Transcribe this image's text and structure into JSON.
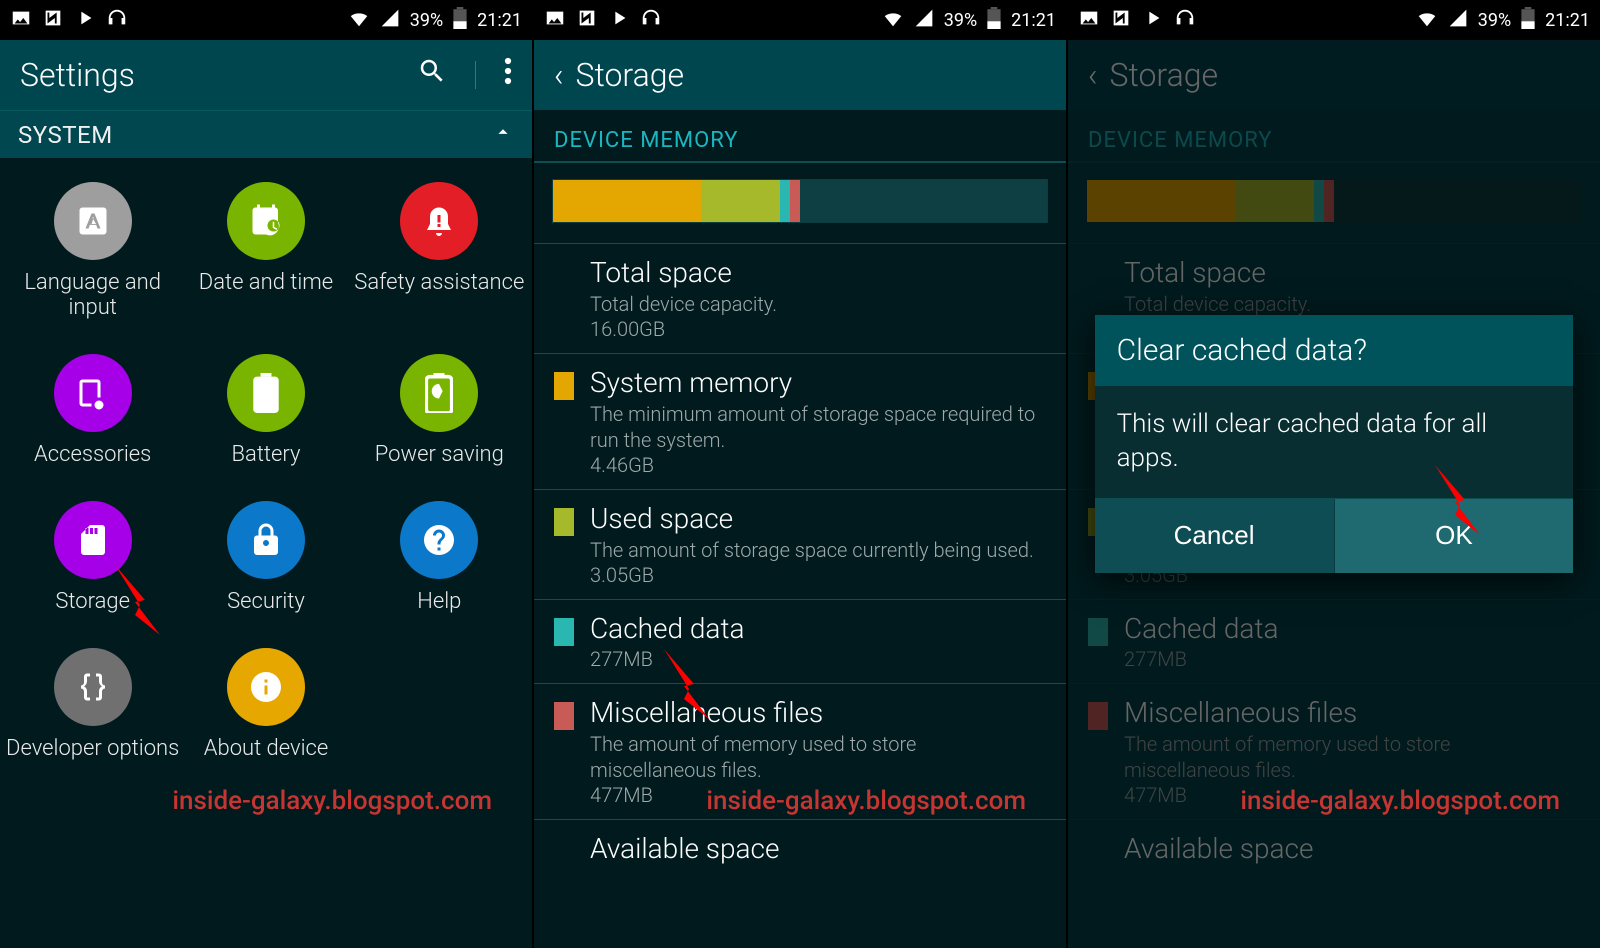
{
  "status_bar": {
    "battery_text": "39%",
    "time": "21:21"
  },
  "watermark": "inside-galaxy.blogspot.com",
  "screen1": {
    "header_title": "Settings",
    "section": "SYSTEM",
    "items": [
      {
        "label": "Language and input"
      },
      {
        "label": "Date and time"
      },
      {
        "label": "Safety assistance"
      },
      {
        "label": "Accessories"
      },
      {
        "label": "Battery"
      },
      {
        "label": "Power saving"
      },
      {
        "label": "Storage"
      },
      {
        "label": "Security"
      },
      {
        "label": "Help"
      },
      {
        "label": "Developer options"
      },
      {
        "label": "About device"
      }
    ]
  },
  "screen2": {
    "header_title": "Storage",
    "section": "DEVICE MEMORY",
    "bar_segments": [
      {
        "color": "#e4a600",
        "pct": 30
      },
      {
        "color": "#a6b92b",
        "pct": 16
      },
      {
        "color": "#2ab7b1",
        "pct": 2
      },
      {
        "color": "#c95b57",
        "pct": 2
      },
      {
        "color": "#0d3f43",
        "pct": 50
      }
    ],
    "rows": [
      {
        "title": "Total space",
        "subtitle": "Total device capacity.",
        "value": "16.00GB",
        "swatch": ""
      },
      {
        "title": "System memory",
        "subtitle": "The minimum amount of storage space required to run the system.",
        "value": "4.46GB",
        "swatch": "#e4a600"
      },
      {
        "title": "Used space",
        "subtitle": "The amount of storage space currently being used.",
        "value": "3.05GB",
        "swatch": "#a6b92b"
      },
      {
        "title": "Cached data",
        "subtitle": "",
        "value": "277MB",
        "swatch": "#2ab7b1"
      },
      {
        "title": "Miscellaneous files",
        "subtitle": "The amount of memory used to store miscellaneous files.",
        "value": "477MB",
        "swatch": "#c95b57"
      },
      {
        "title": "Available space",
        "subtitle": "",
        "value": "",
        "swatch": ""
      }
    ]
  },
  "dialog": {
    "title": "Clear cached data?",
    "body": "This will clear cached data for all apps.",
    "cancel": "Cancel",
    "ok": "OK"
  }
}
